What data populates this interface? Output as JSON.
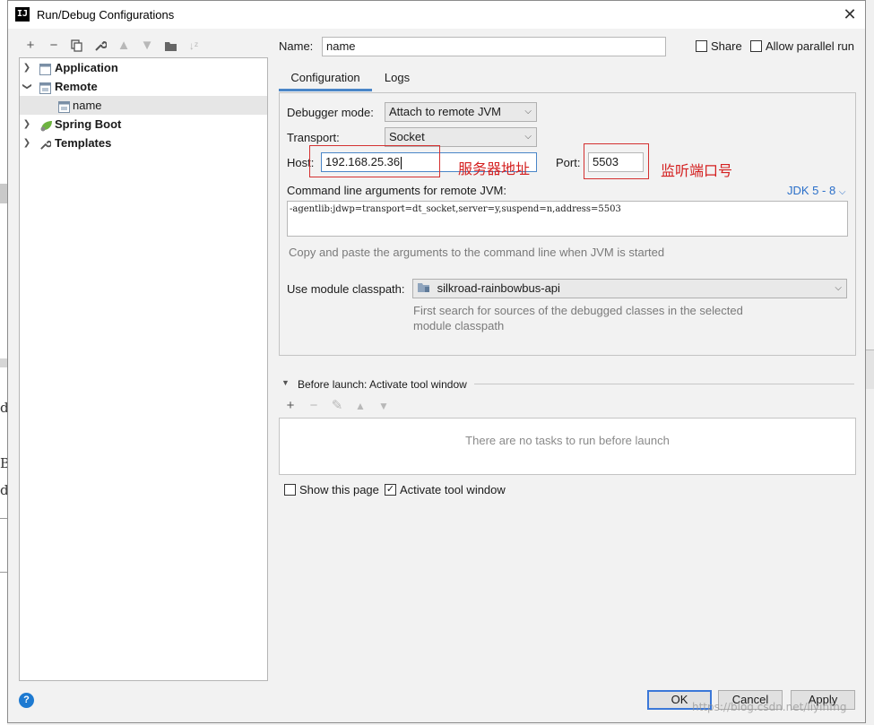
{
  "background_fragments": [
    "d",
    "B",
    "d"
  ],
  "window": {
    "title": "Run/Debug Configurations",
    "app_icon_text": "IJ"
  },
  "toolbar": {
    "icons": [
      "add-icon",
      "remove-icon",
      "copy-icon",
      "wrench-icon",
      "move-up-icon",
      "move-down-icon",
      "folder-icon",
      "sort-icon"
    ]
  },
  "tree": {
    "items": [
      {
        "label": "Application",
        "icon": "application-icon",
        "expanded": false
      },
      {
        "label": "Remote",
        "icon": "remote-icon",
        "expanded": true
      },
      {
        "label": "name",
        "icon": "remote-config-icon",
        "selected": true
      },
      {
        "label": "Spring Boot",
        "icon": "spring-boot-icon",
        "expanded": false
      },
      {
        "label": "Templates",
        "icon": "wrench-icon",
        "expanded": false
      }
    ]
  },
  "header": {
    "name_label": "Name:",
    "name_value": "name",
    "share_label": "Share",
    "share_checked": false,
    "parallel_label": "Allow parallel run",
    "parallel_checked": false
  },
  "tabs": [
    {
      "label": "Configuration",
      "active": true
    },
    {
      "label": "Logs",
      "active": false
    }
  ],
  "config": {
    "debugger_mode_label": "Debugger mode:",
    "debugger_mode_value": "Attach to remote JVM",
    "transport_label": "Transport:",
    "transport_value": "Socket",
    "host_label": "Host:",
    "host_value": "192.168.25.36",
    "host_annotation": "服务器地址",
    "port_label": "Port:",
    "port_value": "5503",
    "port_annotation": "监听端口号",
    "cmd_label": "Command line arguments for remote JVM:",
    "jdk_selector": "JDK 5 - 8",
    "cmd_value": "-agentlib:jdwp=transport=dt_socket,server=y,suspend=n,address=5503",
    "cmd_hint": "Copy and paste the arguments to the command line when JVM is started",
    "module_label": "Use module classpath:",
    "module_value": "silkroad-rainbowbus-api",
    "module_hint_line1": "First search for sources of the debugged classes in the selected",
    "module_hint_line2": "module classpath"
  },
  "before_launch": {
    "title": "Before launch: Activate tool window",
    "empty_text": "There are no tasks to run before launch",
    "icons": [
      "add-icon",
      "remove-icon",
      "edit-icon",
      "move-up-icon",
      "move-down-icon"
    ]
  },
  "footer": {
    "show_page_label": "Show this page",
    "show_page_checked": false,
    "activate_label": "Activate tool window",
    "activate_checked": true,
    "ok_label": "OK",
    "cancel_label": "Cancel",
    "apply_label": "Apply",
    "help_label": "?"
  },
  "watermark": "https://blog.csdn.net/liyinfng",
  "colors": {
    "accent": "#4a86c8",
    "annotation": "#d43030",
    "link": "#2a6fc9"
  }
}
